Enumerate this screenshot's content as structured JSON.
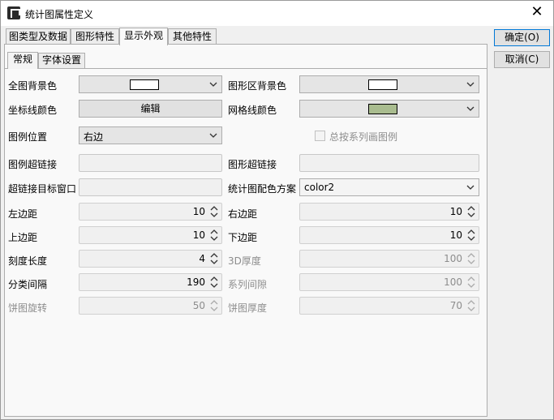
{
  "window": {
    "title": "统计图属性定义",
    "close_glyph": "✕"
  },
  "tabs": [
    "图类型及数据",
    "图形特性",
    "显示外观",
    "其他特性"
  ],
  "subtabs": [
    "常规",
    "字体设置"
  ],
  "buttons": {
    "ok": "确定(O)",
    "cancel": "取消(C)",
    "edit": "编辑"
  },
  "fields": {
    "bg_color": {
      "label": "全图背景色",
      "swatch": "#ffffff"
    },
    "plot_bg_color": {
      "label": "图形区背景色",
      "swatch": "#ffffff"
    },
    "axis_color": {
      "label": "坐标线颜色"
    },
    "grid_color": {
      "label": "网格线颜色",
      "swatch": "#a9bc8f"
    },
    "legend_pos": {
      "label": "图例位置",
      "value": "右边"
    },
    "legend_all": {
      "label": "总按系列画图例"
    },
    "legend_link": {
      "label": "图例超链接"
    },
    "graph_link": {
      "label": "图形超链接"
    },
    "link_target": {
      "label": "超链接目标窗口"
    },
    "color_scheme": {
      "label": "统计图配色方案",
      "value": "color2"
    },
    "left_margin": {
      "label": "左边距",
      "value": "10"
    },
    "right_margin": {
      "label": "右边距",
      "value": "10"
    },
    "top_margin": {
      "label": "上边距",
      "value": "10"
    },
    "bottom_margin": {
      "label": "下边距",
      "value": "10"
    },
    "tick_length": {
      "label": "刻度长度",
      "value": "4"
    },
    "depth_3d": {
      "label": "3D厚度",
      "value": "100"
    },
    "category_gap": {
      "label": "分类间隔",
      "value": "190"
    },
    "series_gap": {
      "label": "系列间隙",
      "value": "100"
    },
    "pie_rotation": {
      "label": "饼图旋转",
      "value": "50"
    },
    "pie_depth": {
      "label": "饼图厚度",
      "value": "70"
    }
  }
}
